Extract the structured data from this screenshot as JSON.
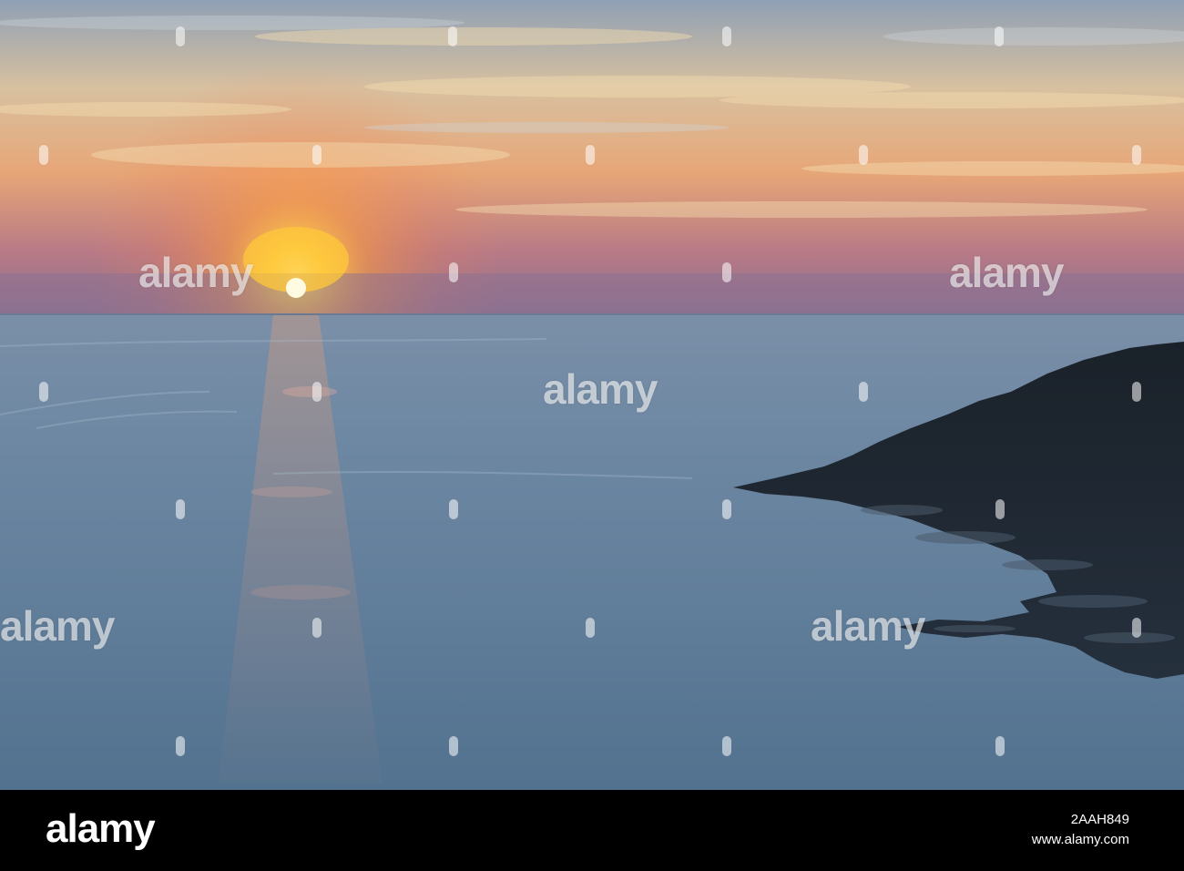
{
  "photo": {
    "watermark_text": "alamy",
    "colors": {
      "sky_top": "#8fa4b6",
      "sky_mid": "#e0b88a",
      "sky_horizon": "#b0708a",
      "sun": "#fff6c8",
      "sun_glow": "#ffb030",
      "sea_far": "#6f8aa6",
      "sea_near": "#4f6f8e",
      "headland": "#1c2430"
    }
  },
  "footer": {
    "logo": "alamy",
    "image_id": "2AAH849",
    "site": "www.alamy.com"
  }
}
